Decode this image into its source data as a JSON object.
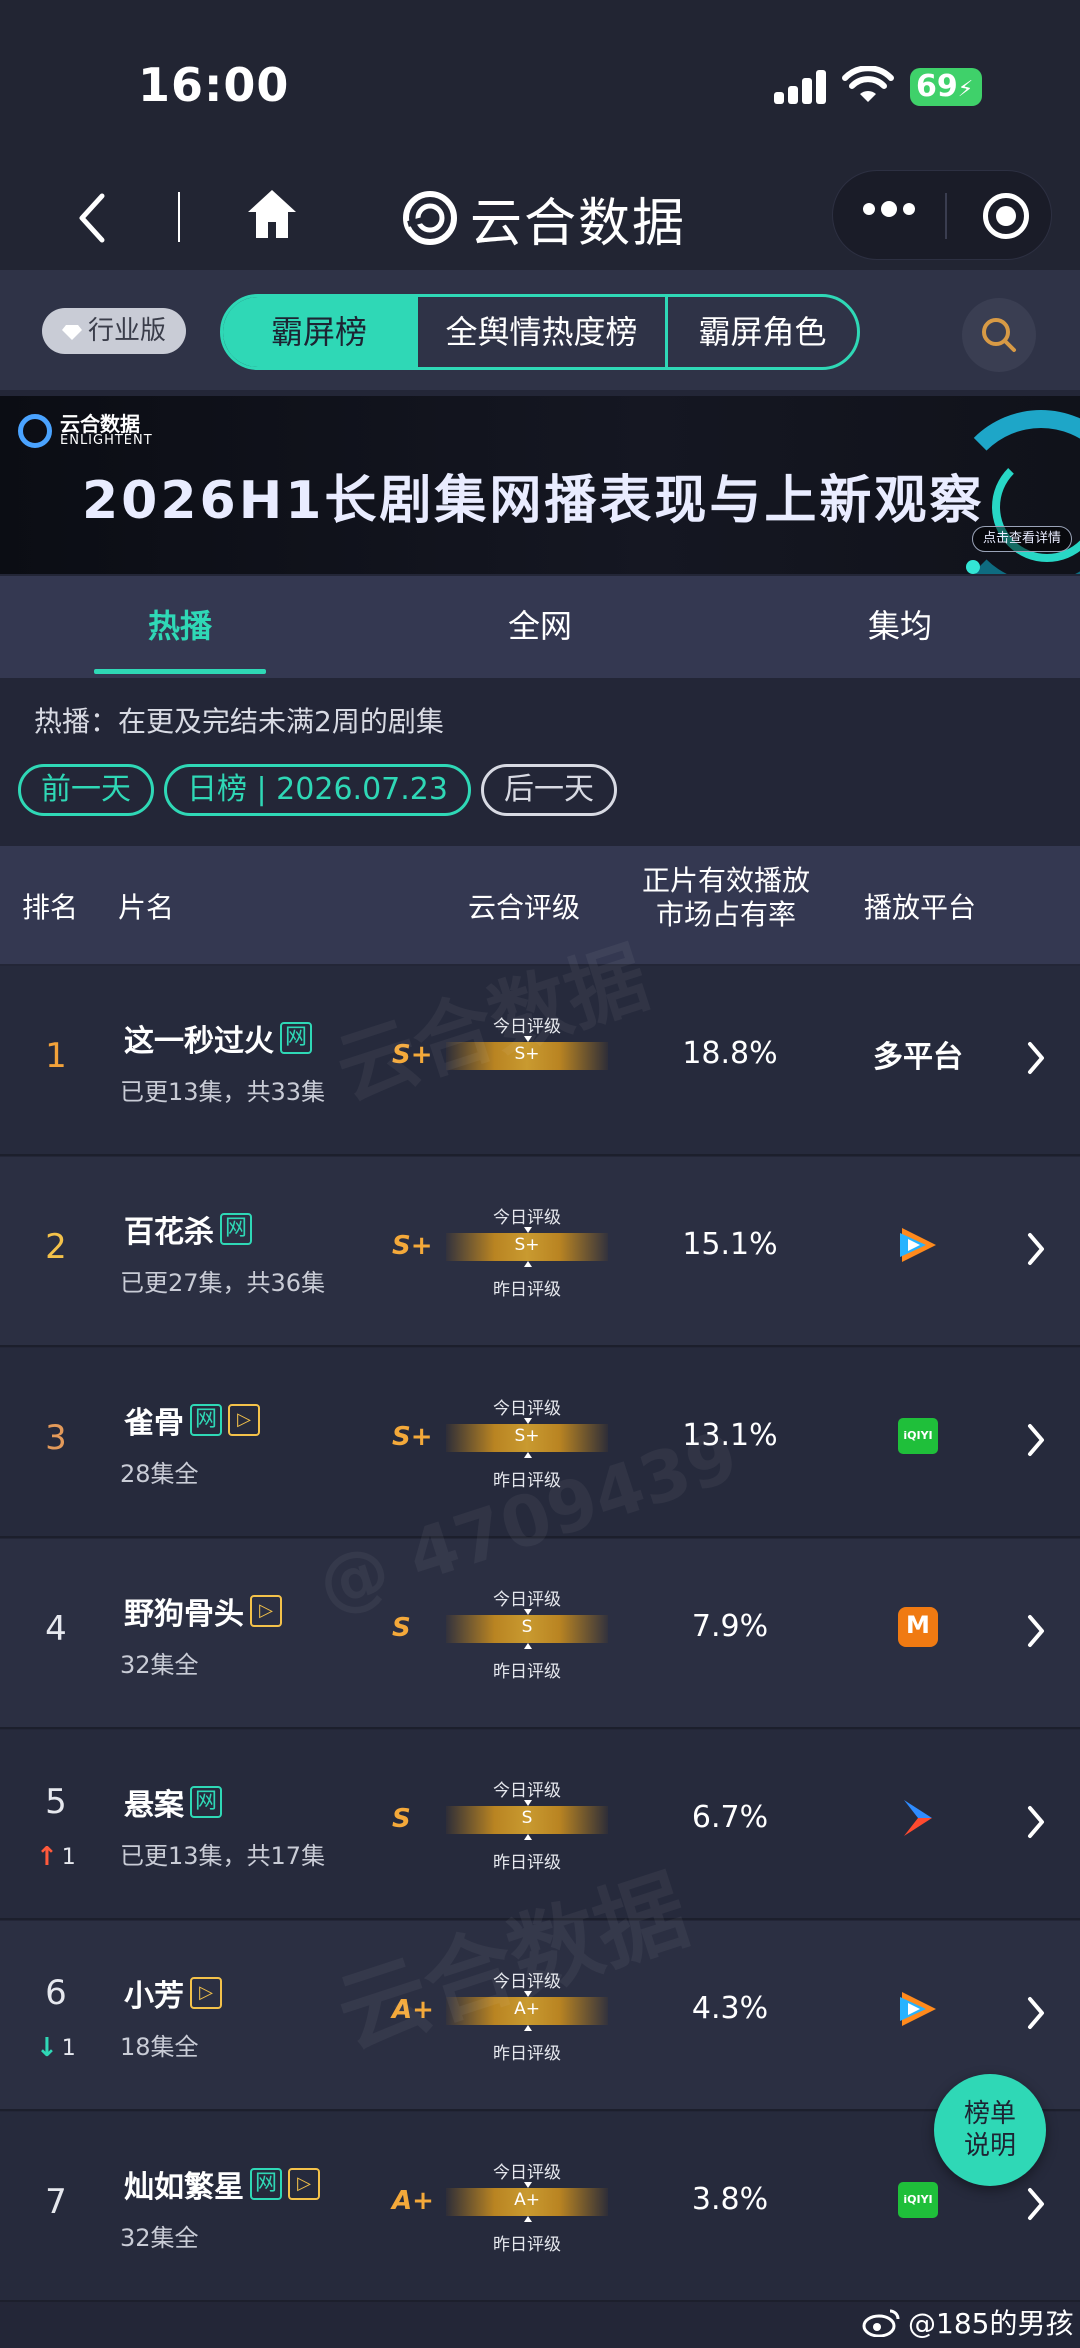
{
  "status_bar": {
    "time": "16:00",
    "battery": "69"
  },
  "nav": {
    "title": "云合数据"
  },
  "top_tabs": {
    "badge": "行业版",
    "tabs": [
      "霸屏榜",
      "全舆情热度榜",
      "霸屏角色"
    ],
    "active": 0
  },
  "banner": {
    "logo_line1": "云合数据",
    "logo_line2": "ENLIGHTENT",
    "title": "2026H1长剧集网播表现与上新观察",
    "button": "点击查看详情"
  },
  "sub_tabs": {
    "tabs": [
      "热播",
      "全网",
      "集均"
    ],
    "active": 0
  },
  "description": "热播：在更及完结未满2周的剧集",
  "date_controls": {
    "prev": "前一天",
    "current": "日榜 | 2026.07.23",
    "next": "后一天"
  },
  "table": {
    "headers": {
      "rank": "排名",
      "name": "片名",
      "grade": "云合评级",
      "share_line1": "正片有效播放",
      "share_line2": "市场占有率",
      "platform": "播放平台"
    },
    "grade_label_today": "今日评级",
    "grade_label_yesterday": "昨日评级",
    "net_tag": "网",
    "rows": [
      {
        "rank": "1",
        "name": "这一秒过火",
        "net": true,
        "play": false,
        "sub": "已更13集，共33集",
        "grade": "S+",
        "bar": "S+",
        "show_yesterday": false,
        "share": "18.8%",
        "platform": "多平台",
        "platform_icon": "text",
        "change": "",
        "dir": ""
      },
      {
        "rank": "2",
        "name": "百花杀",
        "net": true,
        "play": false,
        "sub": "已更27集，共36集",
        "grade": "S+",
        "bar": "S+",
        "show_yesterday": true,
        "share": "15.1%",
        "platform": "",
        "platform_icon": "tencent-video-icon",
        "change": "",
        "dir": ""
      },
      {
        "rank": "3",
        "name": "雀骨",
        "net": true,
        "play": true,
        "sub": "28集全",
        "grade": "S+",
        "bar": "S+",
        "show_yesterday": true,
        "share": "13.1%",
        "platform": "iQIYI",
        "platform_icon": "iqiyi-icon",
        "change": "",
        "dir": ""
      },
      {
        "rank": "4",
        "name": "野狗骨头",
        "net": false,
        "play": true,
        "sub": "32集全",
        "grade": "S",
        "bar": "S",
        "show_yesterday": true,
        "share": "7.9%",
        "platform": "",
        "platform_icon": "mango-tv-icon",
        "change": "",
        "dir": ""
      },
      {
        "rank": "5",
        "name": "悬案",
        "net": true,
        "play": false,
        "sub": "已更13集，共17集",
        "grade": "S",
        "bar": "S",
        "show_yesterday": true,
        "share": "6.7%",
        "platform": "",
        "platform_icon": "youku-icon",
        "change": "1",
        "dir": "up"
      },
      {
        "rank": "6",
        "name": "小芳",
        "net": false,
        "play": true,
        "sub": "18集全",
        "grade": "A+",
        "bar": "A+",
        "show_yesterday": true,
        "share": "4.3%",
        "platform": "",
        "platform_icon": "tencent-video-icon",
        "change": "1",
        "dir": "down"
      },
      {
        "rank": "7",
        "name": "灿如繁星",
        "net": true,
        "play": true,
        "sub": "32集全",
        "grade": "A+",
        "bar": "A+",
        "show_yesterday": true,
        "share": "3.8%",
        "platform": "iQIYI",
        "platform_icon": "iqiyi-icon",
        "change": "",
        "dir": ""
      }
    ]
  },
  "explain_button": {
    "line1": "榜单",
    "line2": "说明"
  },
  "watermark": {
    "user": "@185的男孩",
    "brand": "云合数据",
    "brand_en": "ENLIGHTENT",
    "id": "@ 4709439"
  },
  "colors": {
    "accent": "#2fd8b6",
    "gold": "#f4a93a",
    "background": "#232637"
  }
}
